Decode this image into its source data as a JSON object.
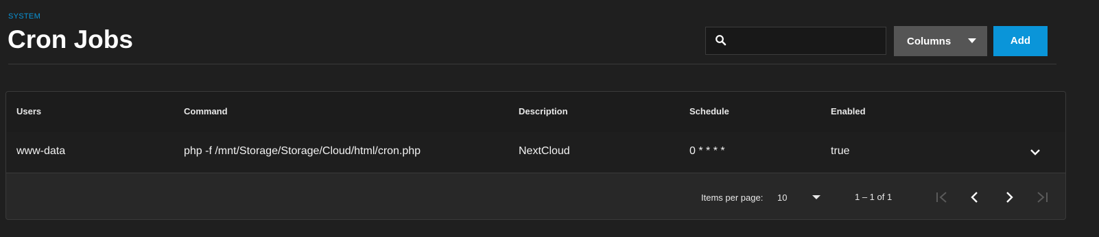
{
  "header": {
    "breadcrumb": "SYSTEM",
    "title": "Cron Jobs",
    "search": {
      "value": "",
      "placeholder": ""
    },
    "columns_label": "Columns",
    "add_label": "Add"
  },
  "table": {
    "columns": [
      "Users",
      "Command",
      "Description",
      "Schedule",
      "Enabled"
    ],
    "rows": [
      {
        "user": "www-data",
        "command": "php -f /mnt/Storage/Storage/Cloud/html/cron.php",
        "description": "NextCloud",
        "schedule": "0 * * * *",
        "enabled": "true"
      }
    ]
  },
  "paginator": {
    "items_per_page_label": "Items per page:",
    "items_per_page": "10",
    "range": "1 – 1 of 1",
    "first_enabled": false,
    "prev_enabled": true,
    "next_enabled": true,
    "last_enabled": false
  },
  "colors": {
    "background": "#1f1f1f",
    "accent": "#0a95d9",
    "secondary_button": "#555555",
    "disabled_icon": "#5a5a5a"
  },
  "icons": {
    "search": "search-icon",
    "columns_caret": "caret-down-icon",
    "row_expand": "chevron-down-icon",
    "first": "first-page-icon",
    "prev": "chevron-left-icon",
    "next": "chevron-right-icon",
    "last": "last-page-icon"
  }
}
